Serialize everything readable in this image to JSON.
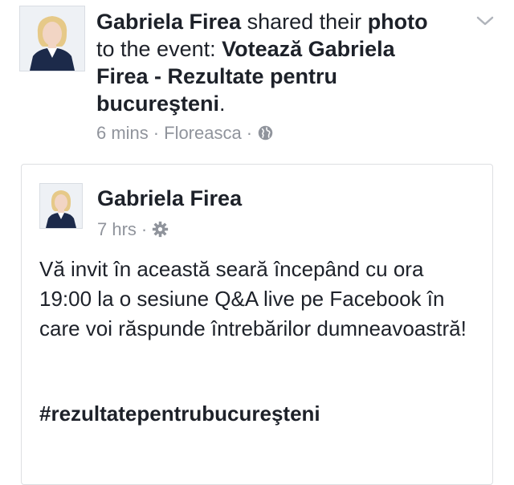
{
  "story": {
    "actor_name": "Gabriela Firea",
    "action_part1": " shared their ",
    "object_word": "photo",
    "action_part2": " to the event: ",
    "event_name": "Votează Gabriela Firea - Rezultate pentru bucureşteni",
    "end_punct": ".",
    "time": "6 mins",
    "separator": "·",
    "location": "Floreasca",
    "privacy_icon": "globe-icon",
    "menu_icon": "chevron-down-icon"
  },
  "post": {
    "author_name": "Gabriela Firea",
    "time": "7 hrs",
    "separator": "·",
    "privacy_icon": "gear-icon",
    "body": "Vă invit în această seară începând cu ora 19:00 la o sesiune Q&A live pe Facebook în care voi răspunde întrebărilor dumneavoastră!",
    "hashtag": "#rezultatepentrubucureşteni"
  },
  "colors": {
    "text": "#1d2129",
    "meta": "#90949c",
    "border": "#dddfe2",
    "suit": "#1c2a4a"
  }
}
